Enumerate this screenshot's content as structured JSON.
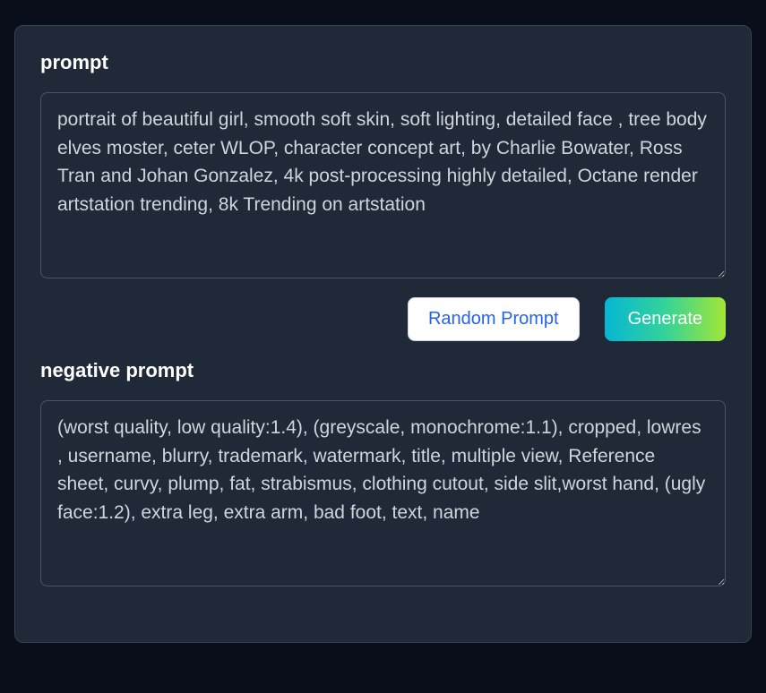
{
  "prompt": {
    "label": "prompt",
    "value": "portrait of beautiful girl, smooth soft skin, soft lighting, detailed face , tree body elves moster, ceter WLOP, character concept art, by Charlie Bowater, Ross Tran and Johan Gonzalez, 4k post-processing highly detailed, Octane render artstation trending, 8k Trending on artstation"
  },
  "negative_prompt": {
    "label": "negative prompt",
    "value": "(worst quality, low quality:1.4), (greyscale, monochrome:1.1), cropped, lowres , username, blurry, trademark, watermark, title, multiple view, Reference sheet, curvy, plump, fat, strabismus, clothing cutout, side slit,worst hand, (ugly face:1.2), extra leg, extra arm, bad foot, text, name"
  },
  "buttons": {
    "random_prompt": "Random Prompt",
    "generate": "Generate"
  }
}
